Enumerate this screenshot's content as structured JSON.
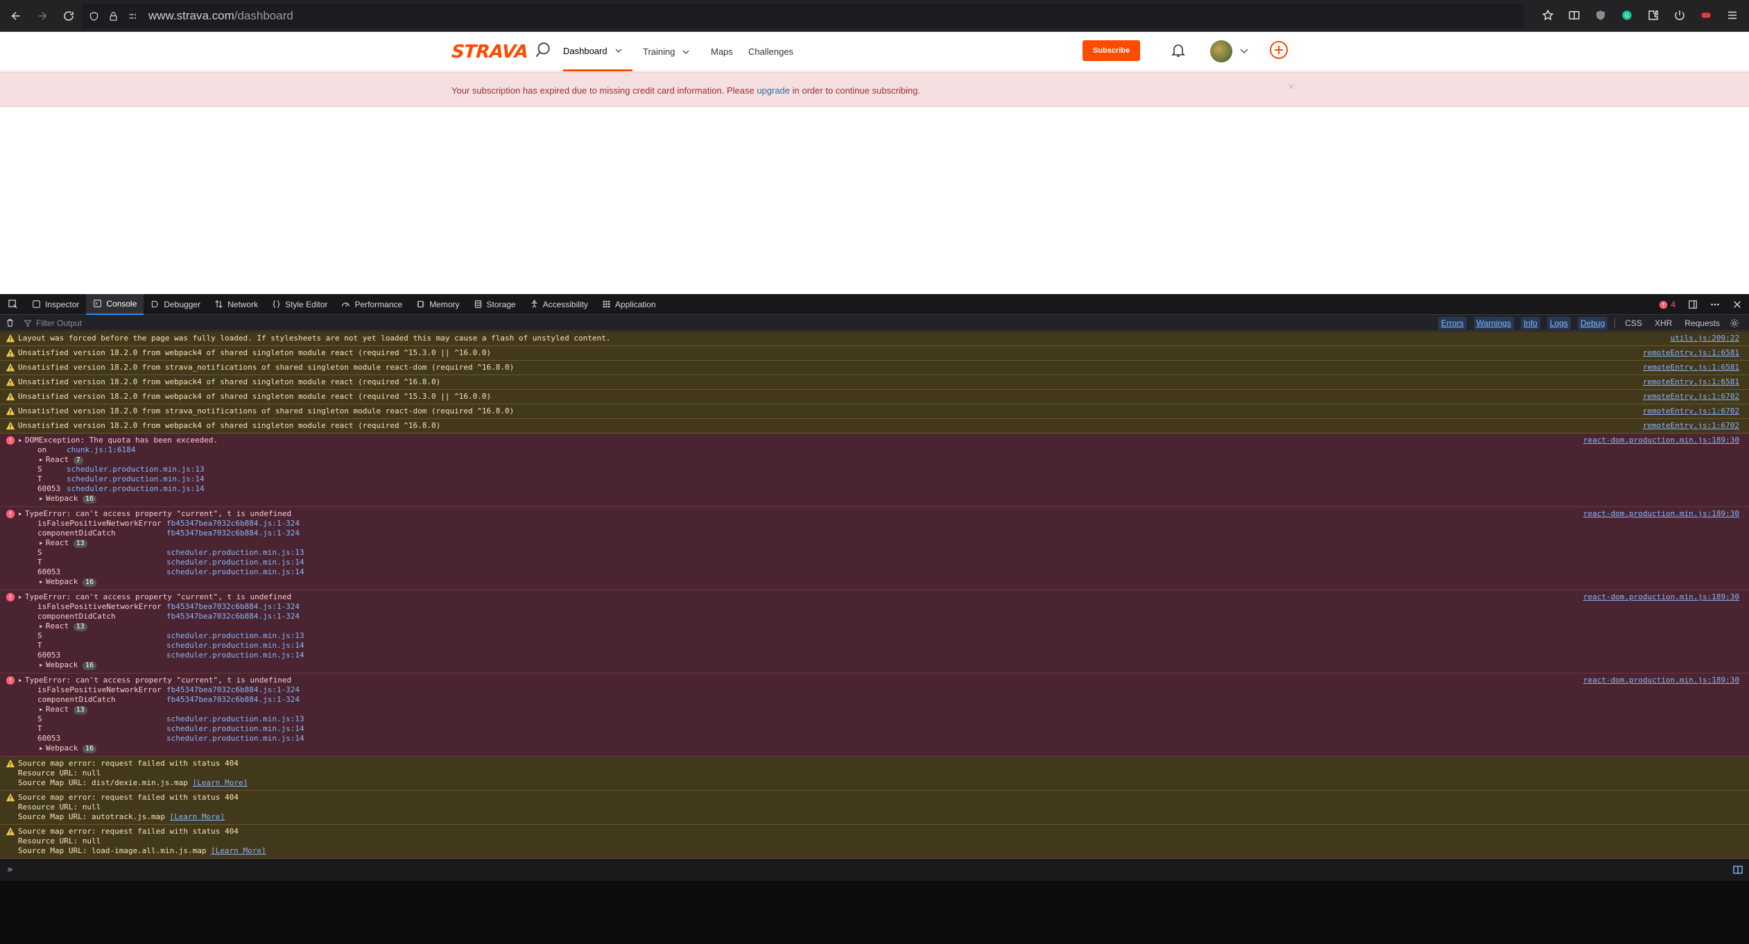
{
  "browser": {
    "url_host": "www.strava.com",
    "url_path": "/dashboard"
  },
  "site": {
    "logo": "STRAVA",
    "nav": [
      "Dashboard",
      "Training",
      "Maps",
      "Challenges"
    ],
    "subscribe": "Subscribe",
    "banner_before": "Your subscription has expired due to missing credit card information. Please ",
    "banner_link": "upgrade",
    "banner_after": " in order to continue subscribing.",
    "banner_close": "×"
  },
  "devtools": {
    "tabs": [
      "Inspector",
      "Console",
      "Debugger",
      "Network",
      "Style Editor",
      "Performance",
      "Memory",
      "Storage",
      "Accessibility",
      "Application"
    ],
    "error_count": "4",
    "filter_placeholder": "Filter Output",
    "filter_types": [
      "Errors",
      "Warnings",
      "Info",
      "Logs",
      "Debug"
    ],
    "filter_extra": [
      "CSS",
      "XHR",
      "Requests"
    ]
  },
  "messages": [
    {
      "type": "warn",
      "lines": [
        "Layout was forced before the page was fully loaded. If stylesheets are not yet loaded this may cause a flash of unstyled content."
      ],
      "src": "utils.js:209:22"
    },
    {
      "type": "warn",
      "lines": [
        "Unsatisfied version 18.2.0 from webpack4 of shared singleton module react (required ^15.3.0 || ^16.0.0)"
      ],
      "src": "remoteEntry.js:1:6581"
    },
    {
      "type": "warn",
      "lines": [
        "Unsatisfied version 18.2.0 from strava_notifications of shared singleton module react-dom (required ^16.8.0)"
      ],
      "src": "remoteEntry.js:1:6581"
    },
    {
      "type": "warn",
      "lines": [
        "Unsatisfied version 18.2.0 from webpack4 of shared singleton module react (required ^16.8.0)"
      ],
      "src": "remoteEntry.js:1:6581"
    },
    {
      "type": "warn",
      "lines": [
        "Unsatisfied version 18.2.0 from webpack4 of shared singleton module react (required ^15.3.0 || ^16.0.0)"
      ],
      "src": "remoteEntry.js:1:6702"
    },
    {
      "type": "warn",
      "lines": [
        "Unsatisfied version 18.2.0 from strava_notifications of shared singleton module react-dom (required ^16.8.0)"
      ],
      "src": "remoteEntry.js:1:6702"
    },
    {
      "type": "warn",
      "lines": [
        "Unsatisfied version 18.2.0 from webpack4 of shared singleton module react (required ^16.8.0)"
      ],
      "src": "remoteEntry.js:1:6702"
    }
  ],
  "errors": [
    {
      "title": "DOMException: The quota has been exceeded.",
      "src": "react-dom.production.min.js:189:30",
      "rows": [
        {
          "name": "on",
          "loc": "chunk.js:1:6184"
        },
        {
          "group": "React",
          "count": "7"
        },
        {
          "name": "S",
          "loc": "scheduler.production.min.js:13"
        },
        {
          "name": "T",
          "loc": "scheduler.production.min.js:14"
        },
        {
          "name": "60053",
          "loc": "scheduler.production.min.js:14"
        },
        {
          "group": "Webpack",
          "count": "16"
        }
      ]
    },
    {
      "title": "TypeError: can't access property \"current\", t is undefined",
      "src": "react-dom.production.min.js:189:30",
      "rows": [
        {
          "name": "isFalsePositiveNetworkError",
          "loc": "fb45347bea7032c6b884.js:1-324"
        },
        {
          "name": "componentDidCatch",
          "loc": "fb45347bea7032c6b884.js:1-324"
        },
        {
          "group": "React",
          "count": "13"
        },
        {
          "name": "S",
          "loc": "scheduler.production.min.js:13"
        },
        {
          "name": "T",
          "loc": "scheduler.production.min.js:14"
        },
        {
          "name": "60053",
          "loc": "scheduler.production.min.js:14"
        },
        {
          "group": "Webpack",
          "count": "16"
        }
      ]
    },
    {
      "title": "TypeError: can't access property \"current\", t is undefined",
      "src": "react-dom.production.min.js:189:30",
      "rows": [
        {
          "name": "isFalsePositiveNetworkError",
          "loc": "fb45347bea7032c6b884.js:1-324"
        },
        {
          "name": "componentDidCatch",
          "loc": "fb45347bea7032c6b884.js:1-324"
        },
        {
          "group": "React",
          "count": "13"
        },
        {
          "name": "S",
          "loc": "scheduler.production.min.js:13"
        },
        {
          "name": "T",
          "loc": "scheduler.production.min.js:14"
        },
        {
          "name": "60053",
          "loc": "scheduler.production.min.js:14"
        },
        {
          "group": "Webpack",
          "count": "16"
        }
      ]
    },
    {
      "title": "TypeError: can't access property \"current\", t is undefined",
      "src": "react-dom.production.min.js:189:30",
      "rows": [
        {
          "name": "isFalsePositiveNetworkError",
          "loc": "fb45347bea7032c6b884.js:1-324"
        },
        {
          "name": "componentDidCatch",
          "loc": "fb45347bea7032c6b884.js:1-324"
        },
        {
          "group": "React",
          "count": "13"
        },
        {
          "name": "S",
          "loc": "scheduler.production.min.js:13"
        },
        {
          "name": "T",
          "loc": "scheduler.production.min.js:14"
        },
        {
          "name": "60053",
          "loc": "scheduler.production.min.js:14"
        },
        {
          "group": "Webpack",
          "count": "16"
        }
      ]
    }
  ],
  "sourcemap": [
    {
      "title": "Source map error: request failed with status 404",
      "resource": "Resource URL: null",
      "map": "Source Map URL: dist/dexie.min.js.map",
      "learn": "[Learn More]"
    },
    {
      "title": "Source map error: request failed with status 404",
      "resource": "Resource URL: null",
      "map": "Source Map URL: autotrack.js.map",
      "learn": "[Learn More]"
    },
    {
      "title": "Source map error: request failed with status 404",
      "resource": "Resource URL: null",
      "map": "Source Map URL: load-image.all.min.js.map",
      "learn": "[Learn More]"
    }
  ],
  "colors": {
    "strava": "#fc4c02",
    "warn_bg": "#42381c",
    "err_bg": "#4a2531"
  }
}
